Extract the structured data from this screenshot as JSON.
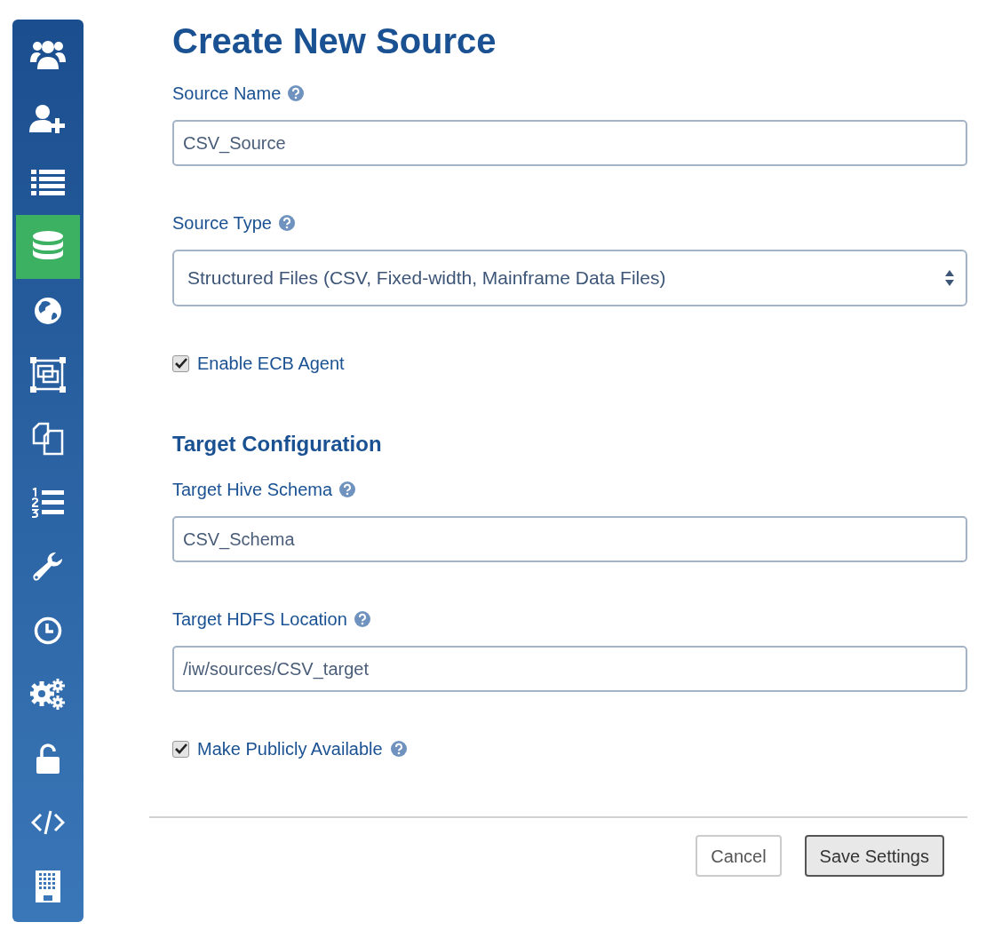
{
  "sidebar": {
    "items": [
      {
        "selected": false
      },
      {
        "selected": false
      },
      {
        "selected": false
      },
      {
        "selected": true
      },
      {
        "selected": false
      },
      {
        "selected": false
      },
      {
        "selected": false
      },
      {
        "selected": false
      },
      {
        "selected": false
      },
      {
        "selected": false
      },
      {
        "selected": false
      },
      {
        "selected": false
      },
      {
        "selected": false
      },
      {
        "selected": false
      }
    ]
  },
  "title": "Create New Source",
  "form": [
    {
      "kind": "text",
      "label": "Source Name",
      "help": true,
      "value": "CSV_Source"
    },
    {
      "kind": "select",
      "label": "Source Type",
      "help": true,
      "value": "Structured Files (CSV, Fixed-width, Mainframe Data Files)"
    },
    {
      "kind": "checkbox",
      "label": "Enable ECB Agent",
      "help": false,
      "checked": true
    },
    {
      "kind": "heading",
      "label": "Target Configuration"
    },
    {
      "kind": "text",
      "label": "Target Hive Schema",
      "help": true,
      "value": "CSV_Schema"
    },
    {
      "kind": "text",
      "label": "Target HDFS Location",
      "help": true,
      "value": "/iw/sources/CSV_target"
    },
    {
      "kind": "checkbox",
      "label": "Make Publicly Available",
      "help": true,
      "checked": true
    }
  ],
  "buttons": [
    {
      "kind": "secondary",
      "label": "Cancel"
    },
    {
      "kind": "primary",
      "label": "Save Settings"
    }
  ]
}
